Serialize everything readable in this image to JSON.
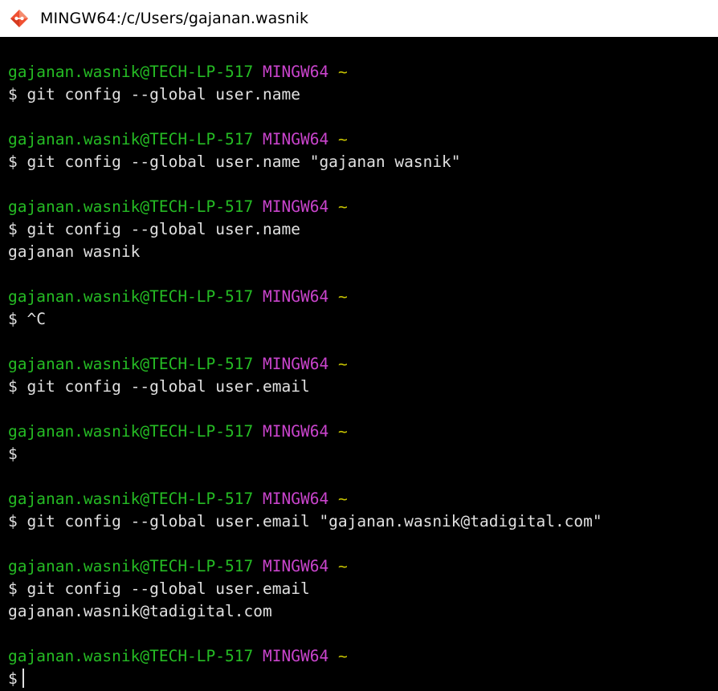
{
  "window": {
    "title": "MINGW64:/c/Users/gajanan.wasnik",
    "icon": "git-diamond-icon"
  },
  "colors": {
    "terminal_bg": "#000000",
    "text": "#e0e0e0",
    "prompt_user": "#25bc24",
    "prompt_system": "#c944cc",
    "prompt_dir": "#c7c400"
  },
  "prompt": {
    "user_host": "gajanan.wasnik@TECH-LP-517",
    "system": "MINGW64",
    "dir": "~",
    "symbol": "$"
  },
  "blocks": [
    {
      "command": "git config --global user.name",
      "output": ""
    },
    {
      "command": "git config --global user.name \"gajanan wasnik\"",
      "output": ""
    },
    {
      "command": "git config --global user.name",
      "output": "gajanan wasnik"
    },
    {
      "command": "^C",
      "output": ""
    },
    {
      "command": "git config --global user.email",
      "output": ""
    },
    {
      "command": "",
      "output": ""
    },
    {
      "command": "git config --global user.email \"gajanan.wasnik@tadigital.com\"",
      "output": ""
    },
    {
      "command": "git config --global user.email",
      "output": "gajanan.wasnik@tadigital.com"
    },
    {
      "command": "",
      "output": ""
    }
  ]
}
